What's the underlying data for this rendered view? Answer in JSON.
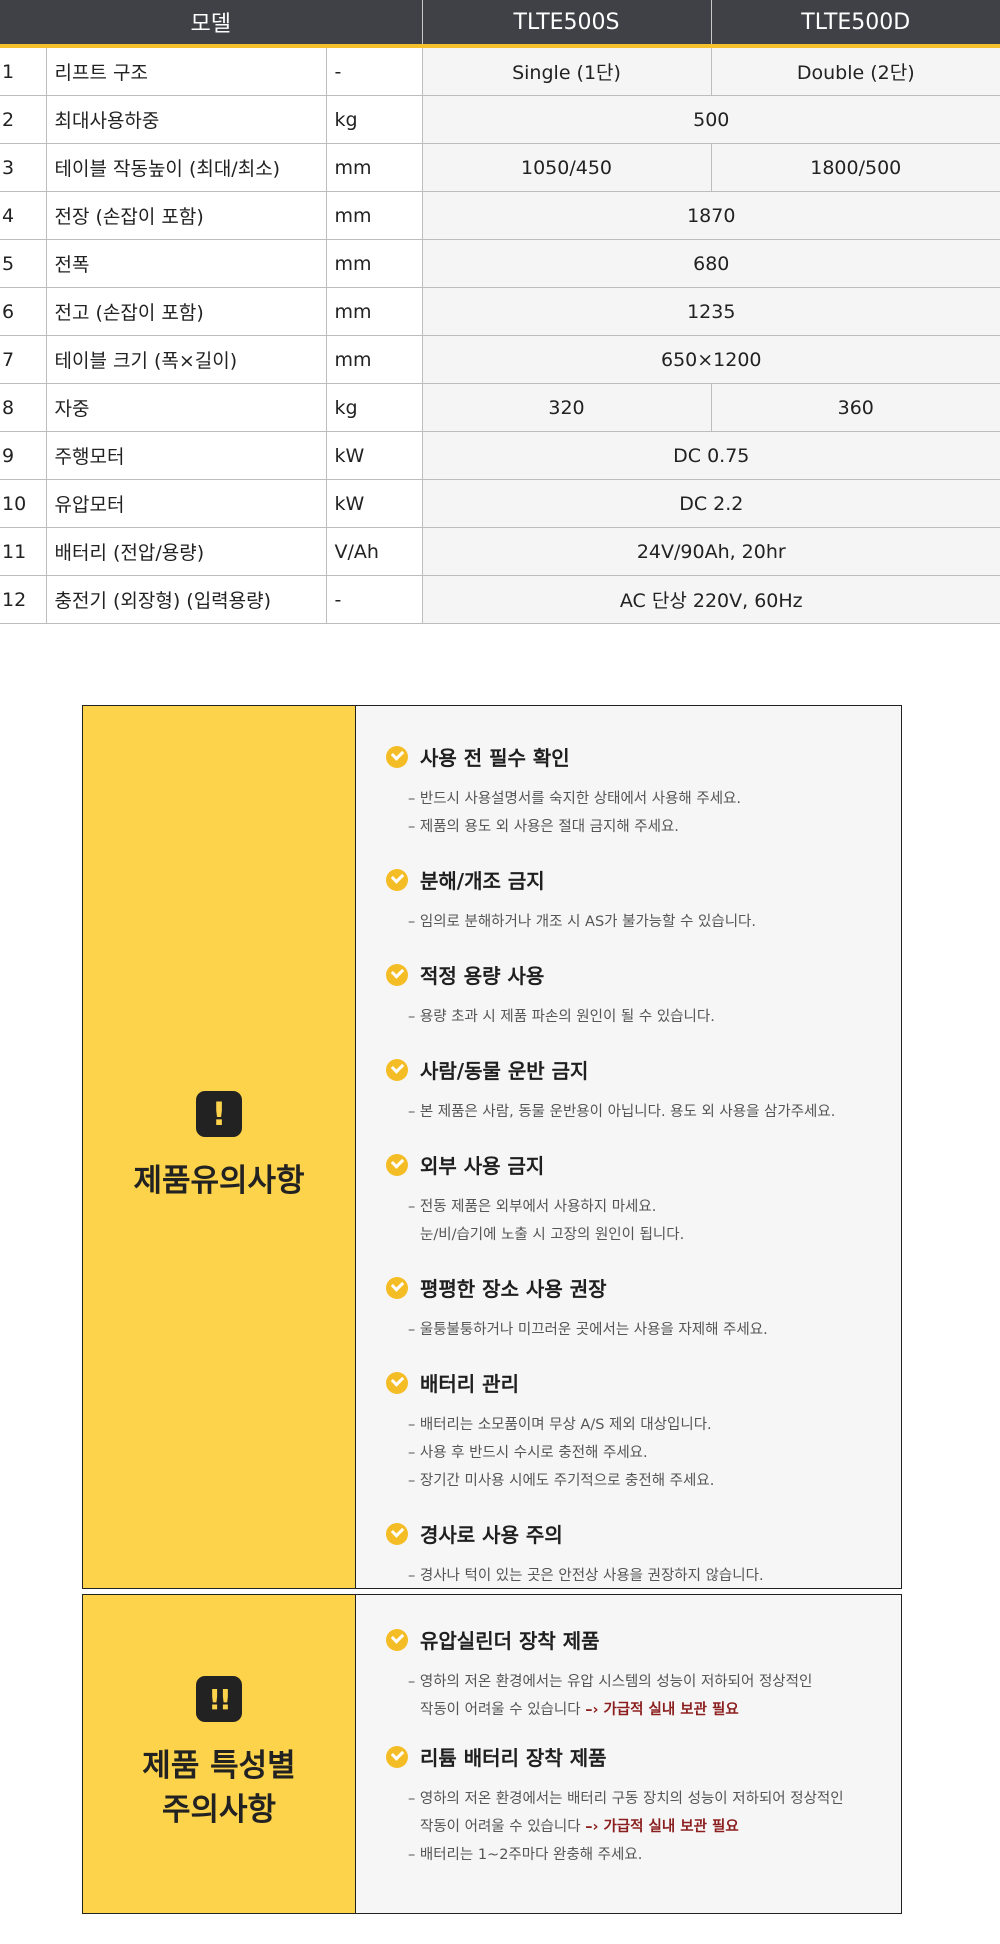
{
  "spec": {
    "header": {
      "model": "모델",
      "col_a": "TLTE500S",
      "col_b": "TLTE500D"
    },
    "rows": [
      {
        "no": "1",
        "item": "리프트 구조",
        "unit": "-",
        "a": "Single (1단)",
        "b": "Double (2단)"
      },
      {
        "no": "2",
        "item": "최대사용하중",
        "unit": "kg",
        "both": "500"
      },
      {
        "no": "3",
        "item": "테이블 작동높이 (최대/최소)",
        "unit": "mm",
        "a": "1050/450",
        "b": "1800/500"
      },
      {
        "no": "4",
        "item": "전장 (손잡이 포함)",
        "unit": "mm",
        "both": "1870"
      },
      {
        "no": "5",
        "item": "전폭",
        "unit": "mm",
        "both": "680"
      },
      {
        "no": "6",
        "item": "전고 (손잡이 포함)",
        "unit": "mm",
        "both": "1235"
      },
      {
        "no": "7",
        "item": "테이블 크기 (폭×길이)",
        "unit": "mm",
        "both": "650×1200"
      },
      {
        "no": "8",
        "item": "자중",
        "unit": "kg",
        "a": "320",
        "b": "360"
      },
      {
        "no": "9",
        "item": "주행모터",
        "unit": "kW",
        "both": "DC 0.75"
      },
      {
        "no": "10",
        "item": "유압모터",
        "unit": "kW",
        "both": "DC 2.2"
      },
      {
        "no": "11",
        "item": "배터리 (전압/용량)",
        "unit": "V/Ah",
        "both": "24V/90Ah, 20hr"
      },
      {
        "no": "12",
        "item": "충전기 (외장형) (입력용량)",
        "unit": "-",
        "both": "AC 단상 220V, 60Hz"
      }
    ]
  },
  "caution1": {
    "icon_name": "exclamation-icon",
    "icon_symbol": "!",
    "title": "제품유의사항",
    "sections": [
      {
        "title": "사용 전 필수 확인",
        "lines": [
          "– 반드시 사용설명서를 숙지한 상태에서 사용해 주세요.",
          "– 제품의 용도 외 사용은 절대 금지해 주세요."
        ]
      },
      {
        "title": "분해/개조 금지",
        "lines": [
          "– 임의로 분해하거나 개조 시 AS가 불가능할 수 있습니다."
        ]
      },
      {
        "title": "적정 용량 사용",
        "lines": [
          "– 용량 초과 시 제품 파손의 원인이 될 수 있습니다."
        ]
      },
      {
        "title": "사람/동물 운반 금지",
        "lines": [
          "– 본 제품은 사람, 동물 운반용이 아닙니다. 용도 외 사용을 삼가주세요."
        ]
      },
      {
        "title": "외부 사용 금지",
        "lines": [
          "– 전동 제품은 외부에서 사용하지 마세요.",
          "눈/비/습기에 노출 시 고장의 원인이 됩니다."
        ]
      },
      {
        "title": "평평한 장소 사용 권장",
        "lines": [
          "– 울퉁불퉁하거나 미끄러운 곳에서는 사용을 자제해 주세요."
        ]
      },
      {
        "title": "배터리 관리",
        "lines": [
          "– 배터리는 소모품이며 무상 A/S 제외 대상입니다.",
          "– 사용 후 반드시 수시로 충전해 주세요.",
          "– 장기간 미사용 시에도 주기적으로 충전해 주세요."
        ]
      },
      {
        "title": "경사로 사용 주의",
        "lines": [
          "– 경사나 턱이 있는 곳은 안전상 사용을 권장하지 않습니다."
        ]
      }
    ]
  },
  "caution2": {
    "icon_name": "double-exclamation-icon",
    "icon_symbol": "!!",
    "title_line1": "제품 특성별",
    "title_line2": "주의사항",
    "sections": [
      {
        "title": "유압실린더 장착 제품",
        "line1": "– 영하의 저온 환경에서는 유압 시스템의 성능이 저하되어 정상적인",
        "line2": "작동이 어려울 수 있습니다",
        "highlight": "–› 가급적 실내 보관 필요"
      },
      {
        "title": "리튬 배터리 장착 제품",
        "line1": "– 영하의 저온 환경에서는 배터리 구동 장치의 성능이 저하되어 정상적인",
        "line2": "작동이 어려울 수 있습니다",
        "highlight": "–› 가급적 실내 보관 필요",
        "line3": "– 배터리는 1~2주마다 완충해 주세요."
      }
    ]
  }
}
